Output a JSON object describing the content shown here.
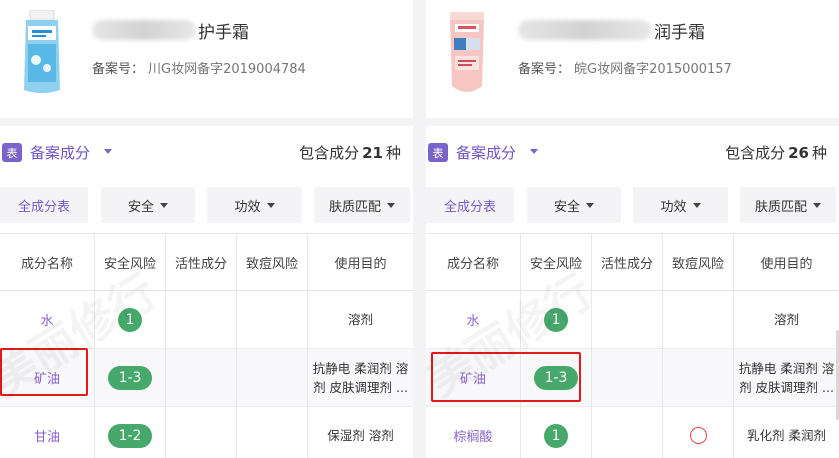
{
  "panels": [
    {
      "product": {
        "name_suffix": "护手霜",
        "reg_label": "备案号：",
        "reg_number": "川G妆网备字2019004784"
      },
      "section": {
        "tag": "表",
        "title": "备案成分",
        "count_prefix": "包含成分",
        "count": "21",
        "count_unit": "种"
      },
      "filters": [
        "全成分表",
        "安全",
        "功效",
        "肤质匹配"
      ],
      "headers": [
        "成分名称",
        "安全风险",
        "活性成分",
        "致痘风险",
        "使用目的"
      ],
      "rows": [
        {
          "name": "水",
          "risk": "1",
          "active": "",
          "acne": "",
          "purpose": "溶剂"
        },
        {
          "name": "矿油",
          "risk": "1-3",
          "active": "",
          "acne": "",
          "purpose": "抗静电 柔润剂 溶剂 皮肤调理剂 ..."
        },
        {
          "name": "甘油",
          "risk": "1-2",
          "active": "",
          "acne": "",
          "purpose": "保湿剂 溶剂"
        }
      ],
      "watermark": "美丽修行"
    },
    {
      "product": {
        "name_suffix": "润手霜",
        "reg_label": "备案号：",
        "reg_number": "皖G妆网备字2015000157"
      },
      "section": {
        "tag": "表",
        "title": "备案成分",
        "count_prefix": "包含成分",
        "count": "26",
        "count_unit": "种"
      },
      "filters": [
        "全成分表",
        "安全",
        "功效",
        "肤质匹配"
      ],
      "headers": [
        "成分名称",
        "安全风险",
        "活性成分",
        "致痘风险",
        "使用目的"
      ],
      "rows": [
        {
          "name": "水",
          "risk": "1",
          "active": "",
          "acne": "",
          "purpose": "溶剂"
        },
        {
          "name": "矿油",
          "risk": "1-3",
          "active": "",
          "acne": "",
          "purpose": "抗静电 柔润剂 溶剂 皮肤调理剂 ..."
        },
        {
          "name": "棕榈酸",
          "risk": "1",
          "active": "",
          "acne": "circle-icon",
          "purpose": "乳化剂 柔润剂"
        }
      ],
      "watermark": "美丽修行"
    }
  ],
  "colors": {
    "accent": "#7a63c9",
    "risk_green": "#47a86b",
    "highlight_red": "#e3191b",
    "acne_red": "#e04646"
  }
}
